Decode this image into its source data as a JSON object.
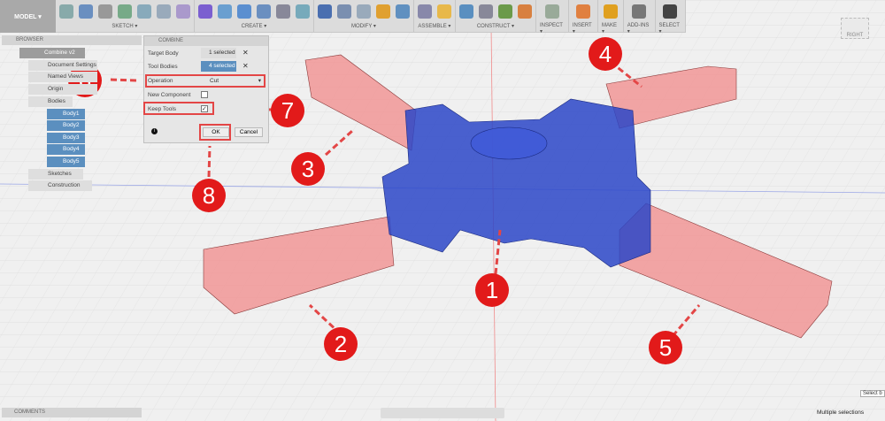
{
  "toolbar": {
    "mode": "MODEL ▾",
    "groups": [
      {
        "label": "SKETCH ▾",
        "icons": [
          "sketch-icon",
          "rectangle-icon",
          "dimension-icon",
          "extrude-sketch-icon",
          "line-icon",
          "circle-icon",
          "pattern-icon"
        ]
      },
      {
        "label": "CREATE ▾",
        "icons": [
          "form-icon",
          "revolve-icon",
          "sweep-icon",
          "box-icon",
          "loft-icon",
          "mirror-icon"
        ]
      },
      {
        "label": "MODIFY ▾",
        "icons": [
          "press-pull-icon",
          "fillet-icon",
          "chamfer-icon",
          "shell-icon",
          "appearance-icon"
        ]
      },
      {
        "label": "ASSEMBLE ▾",
        "icons": [
          "new-component-icon",
          "joint-icon"
        ]
      },
      {
        "label": "CONSTRUCT ▾",
        "icons": [
          "offset-plane-icon",
          "midplane-icon",
          "tangent-plane-icon",
          "plane-angle-icon"
        ]
      },
      {
        "label": "INSPECT ▾",
        "icons": [
          "measure-icon"
        ]
      },
      {
        "label": "INSERT ▾",
        "icons": [
          "insert-image-icon"
        ]
      },
      {
        "label": "MAKE ▾",
        "icons": [
          "3d-print-icon"
        ]
      },
      {
        "label": "ADD-INS ▾",
        "icons": [
          "scripts-icon"
        ]
      },
      {
        "label": "SELECT ▾",
        "icons": [
          "select-icon"
        ]
      }
    ]
  },
  "viewcube": {
    "face": "RIGHT"
  },
  "browser": {
    "title": "BROWSER",
    "root": "Combine v2",
    "items": [
      {
        "label": "Document Settings",
        "type": "gear"
      },
      {
        "label": "Named Views",
        "type": "folder"
      },
      {
        "label": "Origin",
        "type": "folder"
      },
      {
        "label": "Bodies",
        "type": "folder"
      }
    ],
    "bodies": [
      "Body1",
      "Body2",
      "Body3",
      "Body4",
      "Body5"
    ],
    "after": [
      "Sketches",
      "Construction"
    ]
  },
  "combine": {
    "title": "COMBINE",
    "target_label": "Target Body",
    "target_value": "1 selected",
    "tool_label": "Tool Bodies",
    "tool_value": "4 selected",
    "operation_label": "Operation",
    "operation_value": "Cut",
    "new_component_label": "New Component",
    "new_component_checked": false,
    "keep_tools_label": "Keep Tools",
    "keep_tools_checked": true,
    "ok": "OK",
    "cancel": "Cancel"
  },
  "callouts": [
    "1",
    "2",
    "3",
    "4",
    "5",
    "6",
    "7",
    "8"
  ],
  "comments": {
    "title": "COMMENTS"
  },
  "status": {
    "selection": "Multiple selections",
    "hint": "Select b"
  },
  "colors": {
    "tool_body": "#f08080",
    "target_body": "#2b47c8",
    "callout": "#e21a1a"
  }
}
